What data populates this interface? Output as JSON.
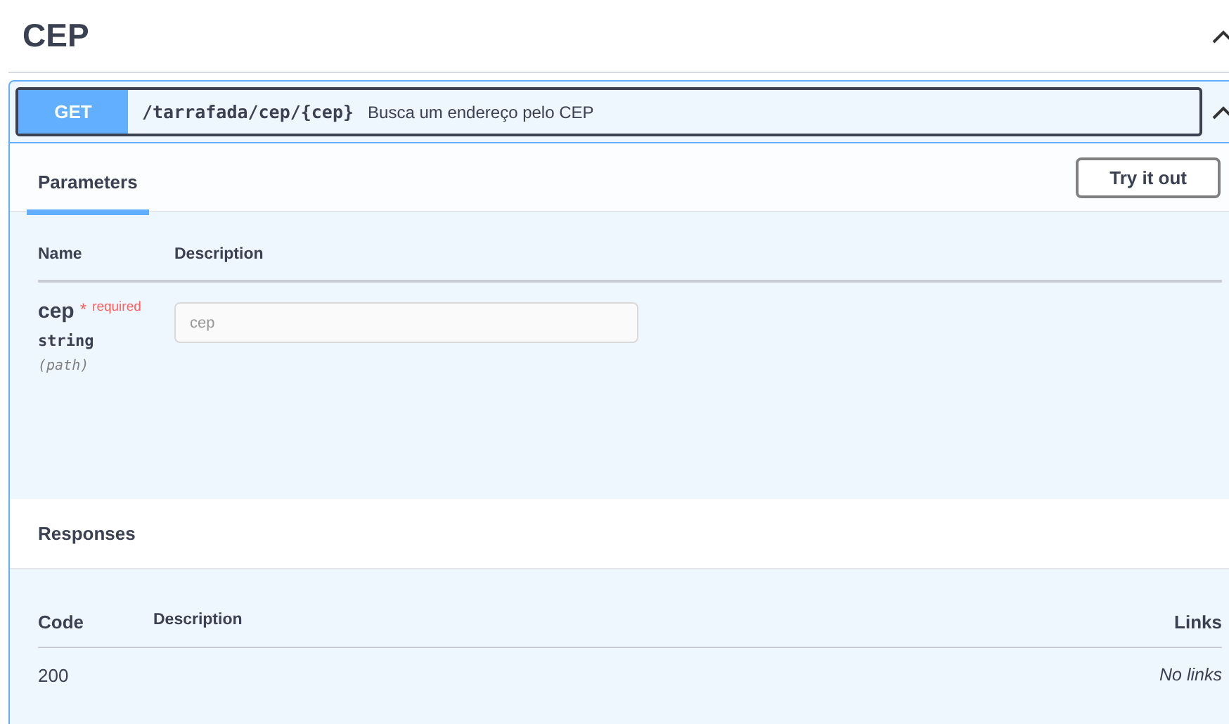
{
  "section": {
    "title": "CEP",
    "expanded": true
  },
  "operation": {
    "method": "GET",
    "path": "/tarrafada/cep/{cep}",
    "summary": "Busca um endereço pelo CEP",
    "expanded": true
  },
  "tabs": [
    {
      "label": "Parameters",
      "selected": true
    }
  ],
  "try_button": "Try it out",
  "parameters": {
    "columns": [
      "Name",
      "Description"
    ],
    "rows": [
      {
        "name": "cep",
        "required_mark": "*",
        "required_label": "required",
        "type": "string",
        "location": "(path)",
        "placeholder": "cep"
      }
    ]
  },
  "responses": {
    "title": "Responses",
    "columns": [
      "Code",
      "Description",
      "Links"
    ],
    "rows": [
      {
        "code": "200",
        "links": "No links"
      }
    ]
  }
}
